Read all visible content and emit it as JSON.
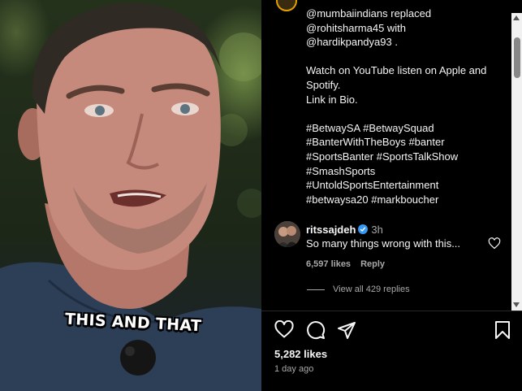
{
  "video": {
    "caption_overlay": "THIS AND THAT"
  },
  "post": {
    "caption": "@mumbaiindians replaced\n@rohitsharma45 with\n@hardikpandya93 .\n\nWatch on YouTube listen on Apple and Spotify.\nLink in Bio.\n\n#BetwaySA #BetwaySquad\n#BanterWithTheBoys #banter\n#SportsBanter #SportsTalkShow\n#SmashSports\n#UntoldSportsEntertainment\n#betwaysa20 #markboucher",
    "comment": {
      "username": "ritssajdeh",
      "time": "3h",
      "text": "So many things wrong with this...",
      "likes": "6,597 likes",
      "reply_label": "Reply",
      "view_replies": "View all 429 replies"
    },
    "likes": "5,282 likes",
    "date": "1 day ago"
  },
  "icons": [
    "heart-icon",
    "comment-icon",
    "share-icon",
    "bookmark-icon",
    "verified-icon"
  ],
  "colors": {
    "background": "#000000",
    "text": "#f5f5f5",
    "muted": "#a8a8a8",
    "verified": "#3897f0"
  }
}
